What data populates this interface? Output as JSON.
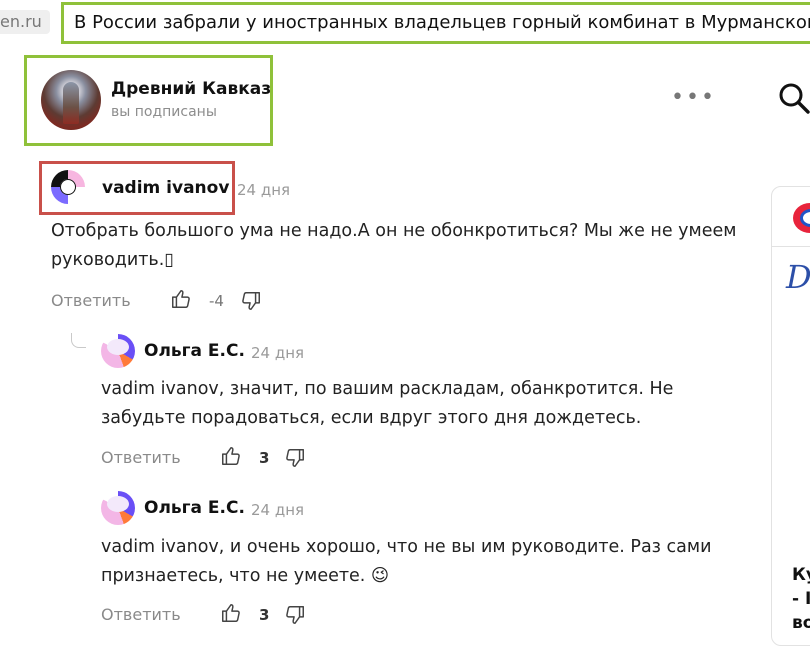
{
  "browser": {
    "url_fragment": "en.ru",
    "headline": "В России забрали у иностранных владельцев горный комбинат в Мурманской о"
  },
  "channel": {
    "name": "Древний Кавказ",
    "subscription_status": "вы подписаны",
    "more_label": "•••"
  },
  "comments": [
    {
      "author": "vadim ivanov",
      "date": "24 дня",
      "text_line1": "Отобрать большого ума не надо.А он не обонкротиться? Мы же не умеем",
      "text_line2": "руководить.▯",
      "reply_label": "Ответить",
      "rating": "-4"
    },
    {
      "author": "Ольга Е.С.",
      "date": "24 дня",
      "text_line1": "vadim ivanov, значит, по вашим раскладам, обанкротится. Не",
      "text_line2": "забудьте порадоваться, если вдруг этого дня дождетесь.",
      "reply_label": "Ответить",
      "rating": "3"
    },
    {
      "author": "Ольга Е.С.",
      "date": "24 дня",
      "text_line1": "vadim ivanov, и очень хорошо, что не вы им руководите. Раз сами",
      "text_line2": "признаетесь, что не умеете. 😉",
      "reply_label": "Ответить",
      "rating": "3"
    }
  ],
  "promo": {
    "script_text": "D",
    "text": "Ку\n- I\nво"
  },
  "icons": {
    "search": "search-icon",
    "like": "thumb-up-icon",
    "dislike": "thumb-down-icon",
    "more": "more-dots-icon"
  },
  "colors": {
    "highlight_green": "#8fc13a",
    "highlight_red": "#c9504a"
  }
}
